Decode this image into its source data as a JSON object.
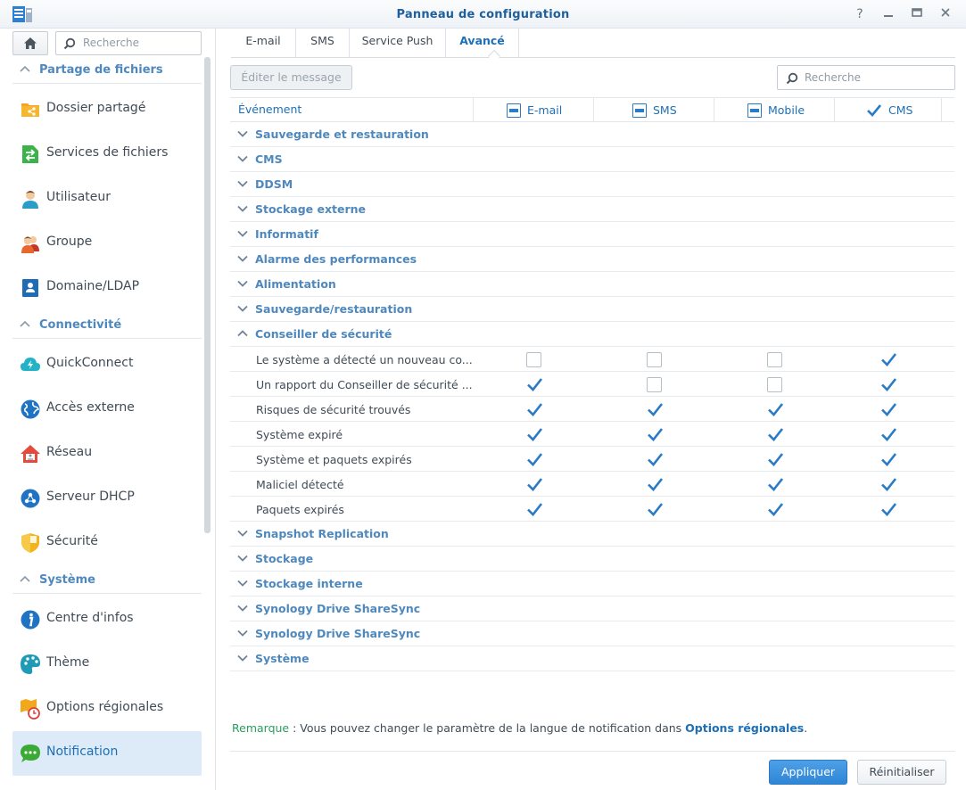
{
  "window": {
    "title": "Panneau de configuration"
  },
  "sidebar": {
    "search_placeholder": "Recherche",
    "sections": [
      {
        "label": "Partage de fichiers",
        "items": [
          {
            "label": "Dossier partagé",
            "icon": "shared-folder-icon"
          },
          {
            "label": "Services de fichiers",
            "icon": "file-services-icon"
          },
          {
            "label": "Utilisateur",
            "icon": "user-icon"
          },
          {
            "label": "Groupe",
            "icon": "group-icon"
          },
          {
            "label": "Domaine/LDAP",
            "icon": "domain-ldap-icon"
          }
        ]
      },
      {
        "label": "Connectivité",
        "items": [
          {
            "label": "QuickConnect",
            "icon": "quickconnect-icon"
          },
          {
            "label": "Accès externe",
            "icon": "globe-icon"
          },
          {
            "label": "Réseau",
            "icon": "network-house-icon"
          },
          {
            "label": "Serveur DHCP",
            "icon": "dhcp-server-icon"
          },
          {
            "label": "Sécurité",
            "icon": "shield-icon"
          }
        ]
      },
      {
        "label": "Système",
        "items": [
          {
            "label": "Centre d'infos",
            "icon": "info-icon"
          },
          {
            "label": "Thème",
            "icon": "palette-icon"
          },
          {
            "label": "Options régionales",
            "icon": "regional-options-icon"
          },
          {
            "label": "Notification",
            "icon": "notification-chat-icon",
            "active": true
          }
        ]
      }
    ]
  },
  "tabs": [
    {
      "label": "E-mail"
    },
    {
      "label": "SMS"
    },
    {
      "label": "Service Push"
    },
    {
      "label": "Avancé",
      "active": true
    }
  ],
  "toolbar": {
    "edit_message": "Éditer le message",
    "search_placeholder": "Recherche"
  },
  "grid": {
    "columns": {
      "event": "Événement",
      "email": "E-mail",
      "sms": "SMS",
      "mobile": "Mobile",
      "cms": "CMS"
    },
    "header_states": [
      "partial",
      "partial",
      "partial",
      "checked"
    ],
    "groups_before": [
      "Sauvegarde et restauration",
      "CMS",
      "DDSM",
      "Stockage externe",
      "Informatif",
      "Alarme des performances",
      "Alimentation",
      "Sauvegarde/restauration"
    ],
    "expanded_group": "Conseiller de sécurité",
    "items": [
      {
        "label": "Le système a détecté un nouveau co...",
        "checks": [
          false,
          false,
          false,
          true
        ]
      },
      {
        "label": "Un rapport du Conseiller de sécurité ...",
        "checks": [
          true,
          false,
          false,
          true
        ]
      },
      {
        "label": "Risques de sécurité trouvés",
        "checks": [
          true,
          true,
          true,
          true
        ]
      },
      {
        "label": "Système expiré",
        "checks": [
          true,
          true,
          true,
          true
        ]
      },
      {
        "label": "Système et paquets expirés",
        "checks": [
          true,
          true,
          true,
          true
        ]
      },
      {
        "label": "Maliciel détecté",
        "checks": [
          true,
          true,
          true,
          true
        ]
      },
      {
        "label": "Paquets expirés",
        "checks": [
          true,
          true,
          true,
          true
        ]
      }
    ],
    "groups_after": [
      "Snapshot Replication",
      "Stockage",
      "Stockage interne",
      "Synology Drive ShareSync",
      "Synology Drive ShareSync",
      "Système"
    ]
  },
  "remark": {
    "key": "Remarque",
    "text": " : Vous pouvez changer le paramètre de la langue de notification dans ",
    "link": "Options régionales",
    "end": "."
  },
  "footer": {
    "apply": "Appliquer",
    "reset": "Réinitialiser"
  },
  "colors": {
    "accent": "#1e6fb5",
    "section": "#4f88bd",
    "active_bg": "#dcebf7",
    "remark_key": "#2a9d5c"
  }
}
